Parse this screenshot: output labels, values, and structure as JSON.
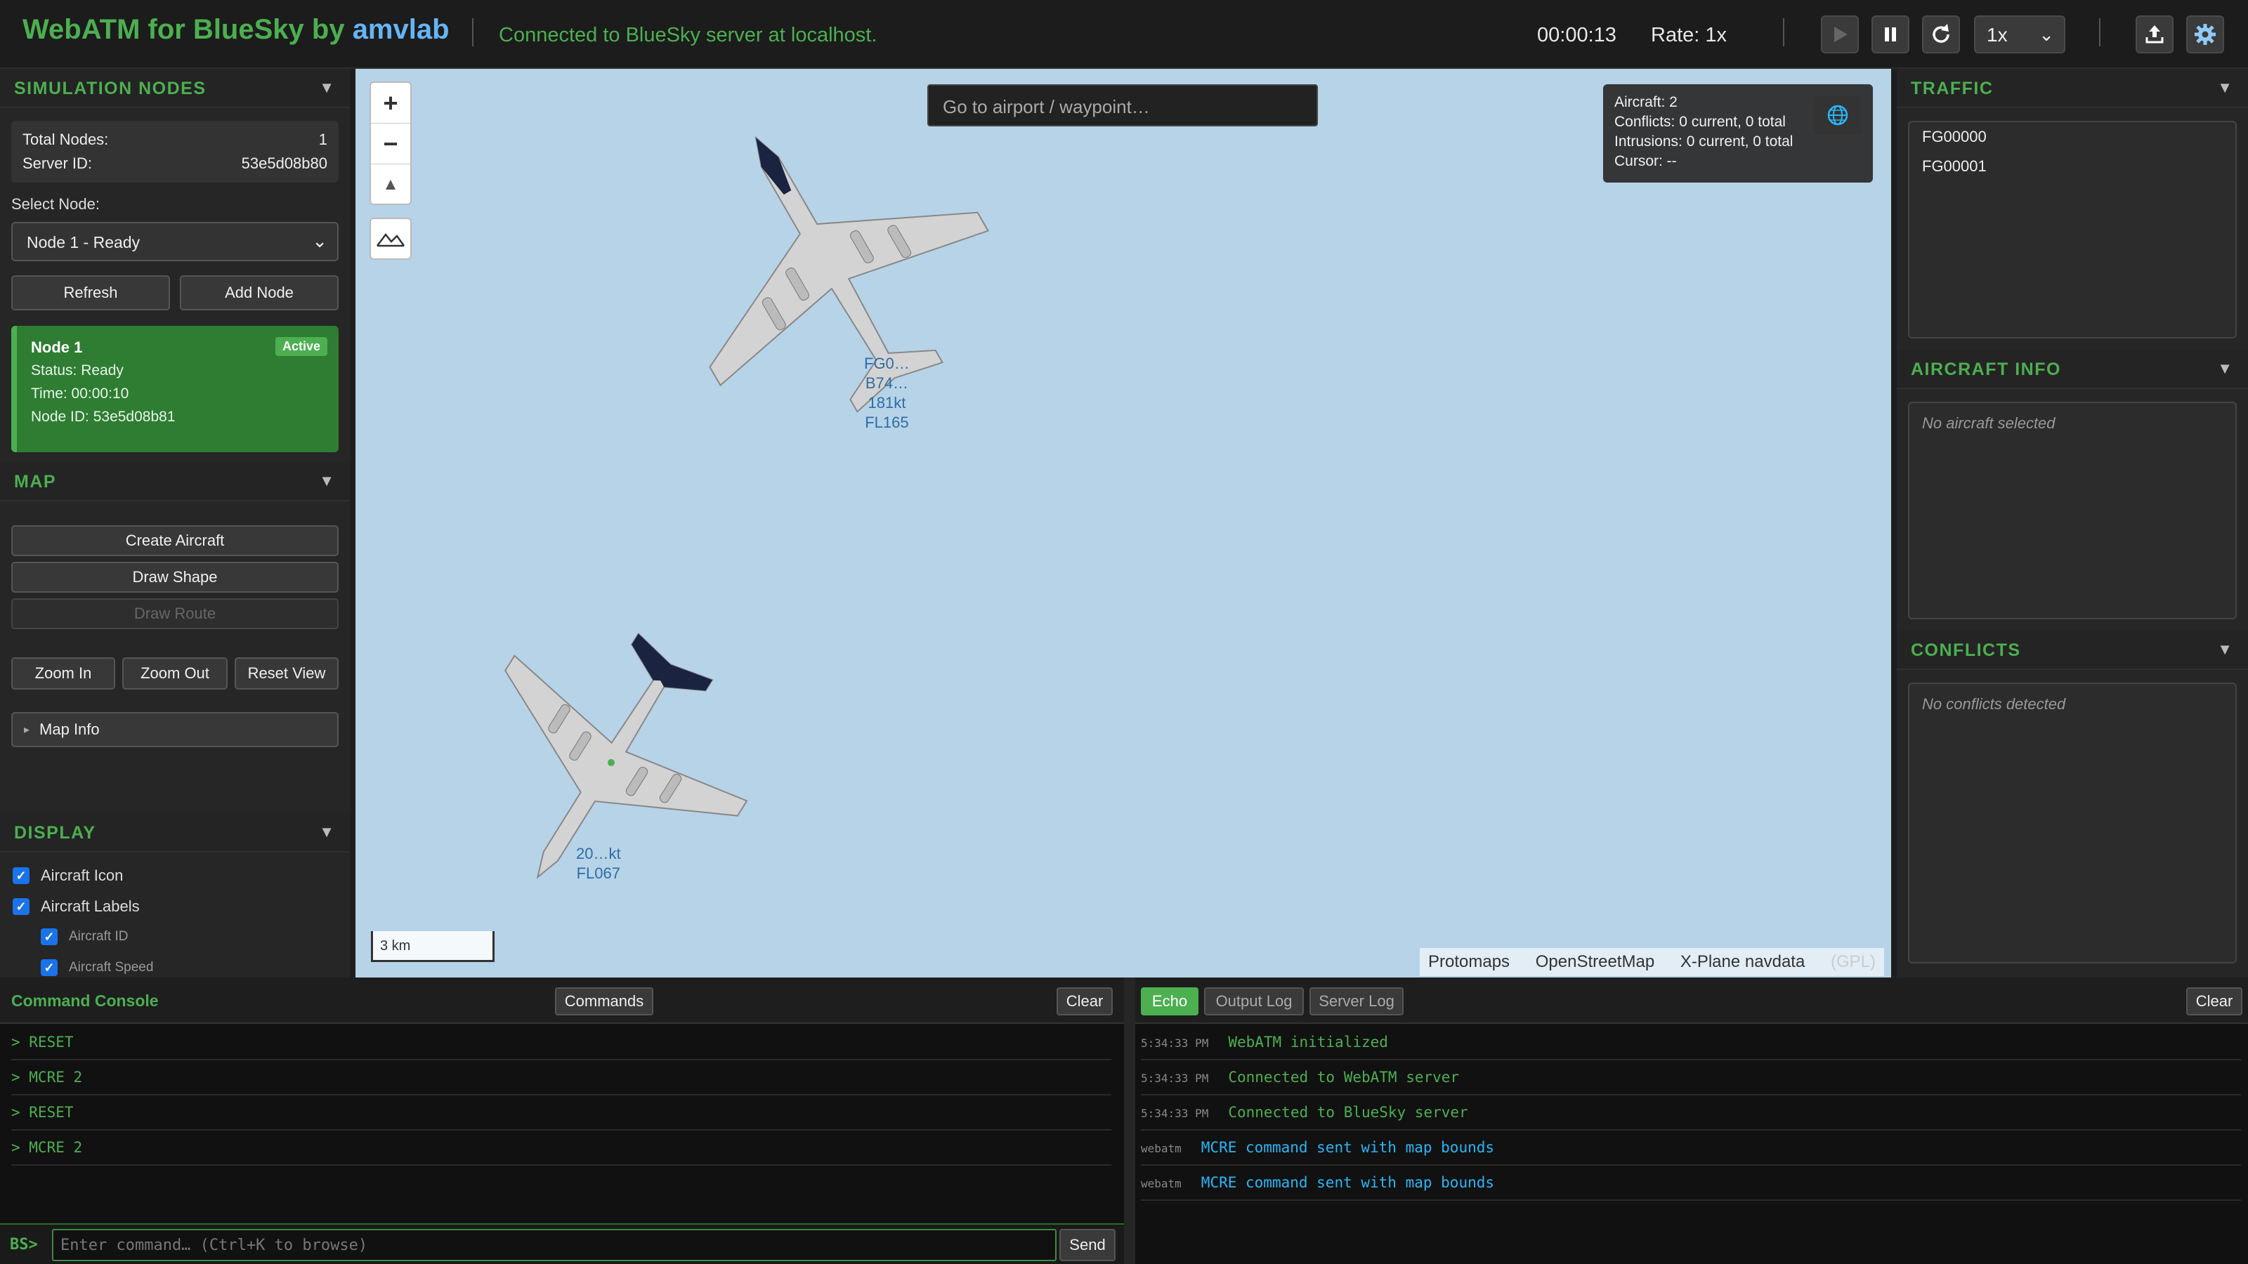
{
  "header": {
    "brand_main": "WebATM for BlueSky by ",
    "brand_lab": "amvlab",
    "separator": "|",
    "connection": "Connected to BlueSky server at localhost.",
    "sim_time": "00:00:13",
    "rate": "Rate: 1x",
    "speed_selected": "1x",
    "icons": [
      "play-icon",
      "pause-icon",
      "refresh-icon",
      "upload-icon",
      "settings-icon"
    ]
  },
  "sim_nodes": {
    "title": "SIMULATION NODES",
    "collapse": "▼",
    "total_nodes_label": "Total Nodes:",
    "total_nodes_value": "1",
    "server_id_label": "Server ID:",
    "server_id_value": "53e5d08b80",
    "select_label": "Select Node:",
    "select_value": "Node 1 - Ready",
    "refresh_label": "Refresh",
    "add_label": "Add Node",
    "node_card": {
      "name": "Node 1",
      "badge": "Active",
      "status": "Status: Ready",
      "time": "Time: 00:00:10",
      "node_id": "Node ID: 53e5d08b81"
    }
  },
  "map_section": {
    "title": "MAP",
    "collapse": "▼",
    "create_aircraft": "Create Aircraft",
    "draw_shape": "Draw Shape",
    "draw_route": "Draw Route",
    "zoom_in": "Zoom In",
    "zoom_out": "Zoom Out",
    "reset_view": "Reset View",
    "map_info": "Map Info",
    "map_info_arrow": "▸"
  },
  "display": {
    "title": "DISPLAY",
    "collapse": "▼",
    "items": [
      {
        "label": "Aircraft Icon",
        "checked": true
      },
      {
        "label": "Aircraft Labels",
        "checked": true
      },
      {
        "label": "Aircraft ID",
        "checked": true
      },
      {
        "label": "Aircraft Speed",
        "checked": true
      }
    ]
  },
  "map": {
    "search_placeholder": "Go to airport / waypoint…",
    "zoom_in_symbol": "+",
    "zoom_out_symbol": "−",
    "compass_symbol": "▲",
    "stats": {
      "aircraft": "Aircraft: 2",
      "conflicts": "Conflicts: 0 current, 0 total",
      "intrusions": "Intrusions: 0 current, 0 total",
      "cursor": "Cursor: --"
    },
    "scale": "3 km",
    "attribution": [
      "Protomaps",
      "OpenStreetMap",
      "X-Plane navdata",
      "(GPL)"
    ],
    "aircraft": [
      {
        "label_lines": [
          "FG0…",
          "B74…",
          "181kt",
          "FL165"
        ]
      },
      {
        "label_lines": [
          "20…kt",
          "FL067"
        ]
      }
    ]
  },
  "traffic": {
    "title": "TRAFFIC",
    "collapse": "▼",
    "items": [
      "FG00000",
      "FG00001"
    ]
  },
  "aircraft_info": {
    "title": "AIRCRAFT INFO",
    "collapse": "▼",
    "empty": "No aircraft selected"
  },
  "conflicts": {
    "title": "CONFLICTS",
    "collapse": "▼",
    "empty": "No conflicts detected"
  },
  "console": {
    "title": "Command Console",
    "commands_button": "Commands",
    "clear_button": "Clear",
    "history": [
      "> RESET",
      "> MCRE 2",
      "> RESET",
      "> MCRE 2"
    ],
    "prompt": "BS>",
    "input_placeholder": "Enter command… (Ctrl+K to browse)",
    "send_button": "Send"
  },
  "log": {
    "tabs": [
      "Echo",
      "Output Log",
      "Server Log"
    ],
    "active_tab": "Echo",
    "clear_button": "Clear",
    "entries": [
      {
        "ts": "5:34:33 PM",
        "msg": "WebATM initialized",
        "color": "#4caf50"
      },
      {
        "ts": "5:34:33 PM",
        "msg": "Connected to WebATM server",
        "color": "#4caf50"
      },
      {
        "ts": "5:34:33 PM",
        "msg": "Connected to BlueSky server",
        "color": "#4caf50"
      },
      {
        "ts": "webatm",
        "msg": "MCRE command sent with map bounds",
        "color": "#29b6f6"
      },
      {
        "ts": "webatm",
        "msg": "MCRE command sent with map bounds",
        "color": "#29b6f6"
      }
    ]
  }
}
